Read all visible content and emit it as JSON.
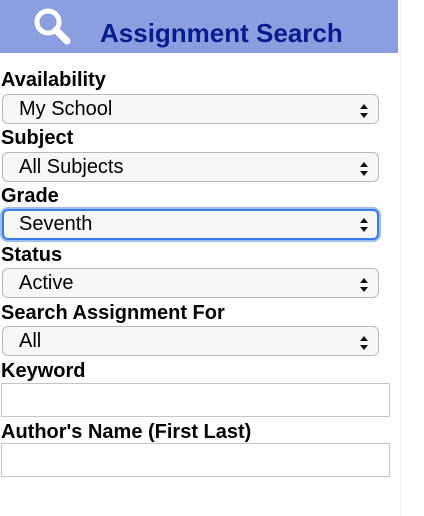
{
  "header": {
    "title": "Assignment Search",
    "icon": "search-icon",
    "background": "#8b9fe0",
    "title_color": "#0a1b8f"
  },
  "fields": {
    "availability": {
      "label": "Availability",
      "value": "My School"
    },
    "subject": {
      "label": "Subject",
      "value": "All Subjects"
    },
    "grade": {
      "label": "Grade",
      "value": "Seventh"
    },
    "status": {
      "label": "Status",
      "value": "Active"
    },
    "search_for": {
      "label": "Search Assignment For",
      "value": "All"
    },
    "keyword": {
      "label": "Keyword",
      "value": ""
    },
    "author": {
      "label": "Author's Name (First Last)",
      "value": ""
    }
  },
  "focus_color": "#3a7bea"
}
